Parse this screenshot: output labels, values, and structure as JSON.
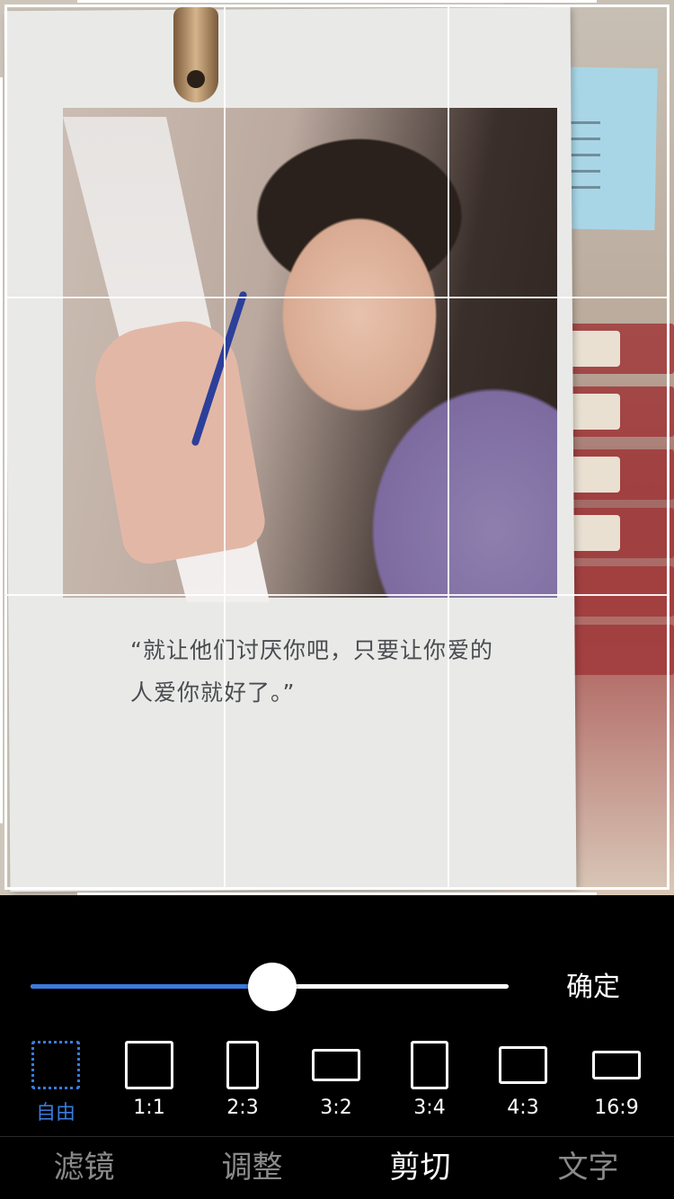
{
  "photo": {
    "quote_line1": "“就让他们讨厌你吧，只要让你爱的",
    "quote_line2": "人爱你就好了。”"
  },
  "crop": {
    "slider_level": 0.505,
    "confirm_label": "确定"
  },
  "ratios": [
    {
      "label": "自由",
      "selected": true
    },
    {
      "label": "1:1",
      "selected": false
    },
    {
      "label": "2:3",
      "selected": false
    },
    {
      "label": "3:2",
      "selected": false
    },
    {
      "label": "3:4",
      "selected": false
    },
    {
      "label": "4:3",
      "selected": false
    },
    {
      "label": "16:9",
      "selected": false
    }
  ],
  "tabs": [
    {
      "label": "滤镜",
      "active": false
    },
    {
      "label": "调整",
      "active": false
    },
    {
      "label": "剪切",
      "active": true
    },
    {
      "label": "文字",
      "active": false
    }
  ],
  "colors": {
    "accent": "#3a7bdc",
    "background": "#000000",
    "inactive_tab": "#8a8a8a"
  }
}
